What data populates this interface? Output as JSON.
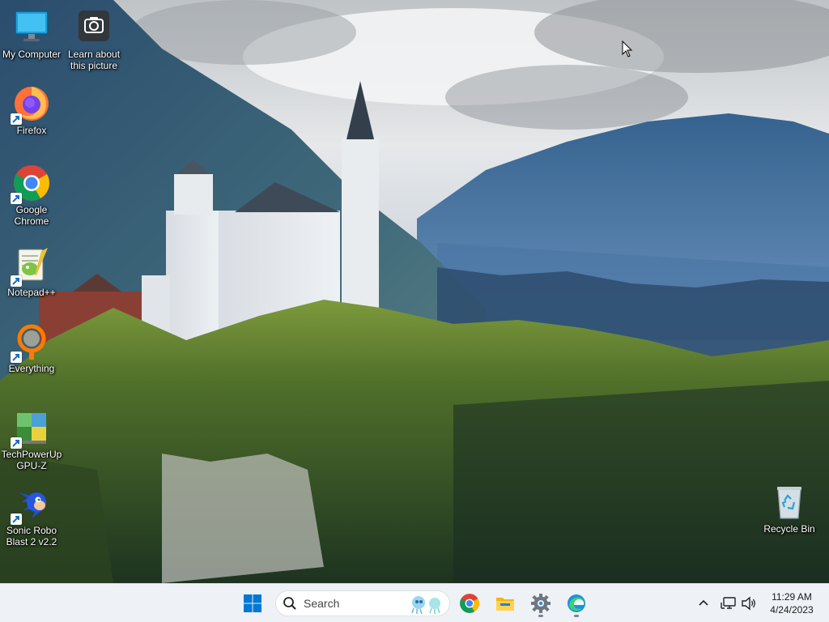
{
  "desktop": {
    "icons": [
      {
        "label": "My Computer"
      },
      {
        "label": "Learn about\nthis picture"
      },
      {
        "label": "Firefox"
      },
      {
        "label": "Google\nChrome"
      },
      {
        "label": "Notepad++"
      },
      {
        "label": "Everything"
      },
      {
        "label": "TechPowerUp\nGPU-Z"
      },
      {
        "label": "Sonic Robo\nBlast 2 v2.2"
      },
      {
        "label": "Recycle Bin"
      }
    ]
  },
  "taskbar": {
    "search": {
      "placeholder": "Search"
    },
    "pinned": [
      "start-icon",
      "chrome-icon",
      "file-explorer-icon",
      "settings-icon",
      "edge-icon"
    ],
    "clock": {
      "time": "11:29 AM",
      "date": "4/24/2023"
    }
  },
  "colors": {
    "taskbar_bg": "#eef1f5",
    "windows_blue": "#0078d4"
  }
}
